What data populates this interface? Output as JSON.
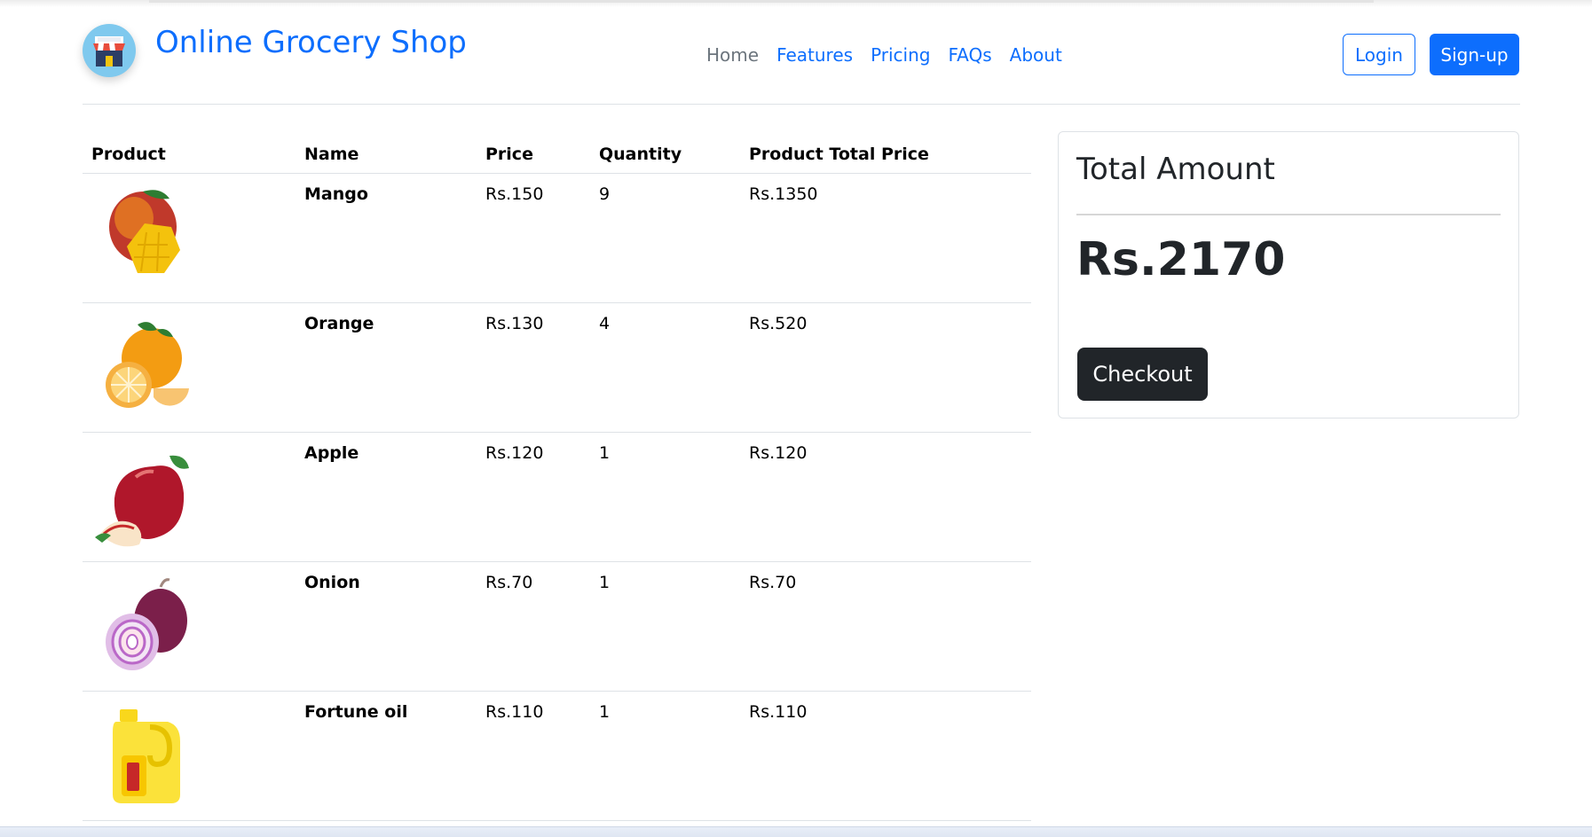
{
  "header": {
    "brand": "Online Grocery Shop",
    "logo_icon": "store-icon",
    "nav": [
      {
        "label": "Home",
        "muted": true
      },
      {
        "label": "Features"
      },
      {
        "label": "Pricing"
      },
      {
        "label": "FAQs"
      },
      {
        "label": "About"
      }
    ],
    "login_label": "Login",
    "signup_label": "Sign-up"
  },
  "cart": {
    "columns": [
      "Product",
      "Name",
      "Price",
      "Quantity",
      "Product Total Price"
    ],
    "rows": [
      {
        "icon": "mango-icon",
        "name": "Mango",
        "price": "Rs.150",
        "quantity": "9",
        "total": "Rs.1350"
      },
      {
        "icon": "orange-icon",
        "name": "Orange",
        "price": "Rs.130",
        "quantity": "4",
        "total": "Rs.520"
      },
      {
        "icon": "apple-icon",
        "name": "Apple",
        "price": "Rs.120",
        "quantity": "1",
        "total": "Rs.120"
      },
      {
        "icon": "onion-icon",
        "name": "Onion",
        "price": "Rs.70",
        "quantity": "1",
        "total": "Rs.70"
      },
      {
        "icon": "oil-can-icon",
        "name": "Fortune oil",
        "price": "Rs.110",
        "quantity": "1",
        "total": "Rs.110"
      }
    ]
  },
  "summary": {
    "title": "Total Amount",
    "amount": "Rs.2170",
    "checkout_label": "Checkout"
  },
  "colors": {
    "primary": "#0d6efd",
    "dark": "#212529",
    "muted": "#6c757d"
  }
}
